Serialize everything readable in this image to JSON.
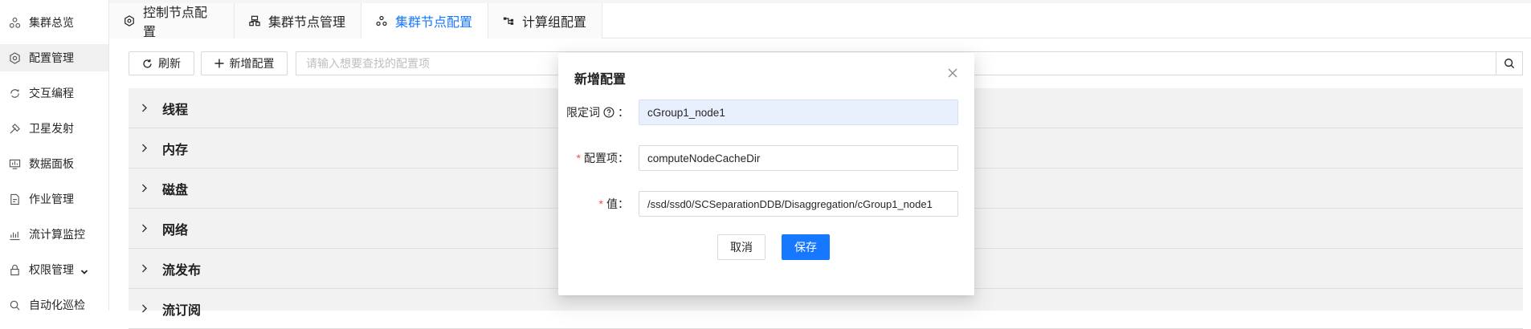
{
  "sidebar": {
    "items": [
      {
        "label": "集群总览",
        "icon": "cluster-overview-icon",
        "active": false
      },
      {
        "label": "配置管理",
        "icon": "settings-icon",
        "active": true
      },
      {
        "label": "交互编程",
        "icon": "interactive-icon",
        "active": false
      },
      {
        "label": "卫星发射",
        "icon": "satellite-icon",
        "active": false
      },
      {
        "label": "数据面板",
        "icon": "dashboard-icon",
        "active": false
      },
      {
        "label": "作业管理",
        "icon": "job-icon",
        "active": false
      },
      {
        "label": "流计算监控",
        "icon": "stream-monitor-icon",
        "active": false
      },
      {
        "label": "权限管理",
        "icon": "lock-icon",
        "active": false,
        "expandable": true
      },
      {
        "label": "自动化巡检",
        "icon": "inspection-icon",
        "active": false
      }
    ]
  },
  "tabs": [
    {
      "label": "控制节点配置",
      "icon": "controller-node-icon",
      "active": false
    },
    {
      "label": "集群节点管理",
      "icon": "cluster-node-manage-icon",
      "active": false
    },
    {
      "label": "集群节点配置",
      "icon": "cluster-node-config-icon",
      "active": true
    },
    {
      "label": "计算组配置",
      "icon": "compute-group-icon",
      "active": false
    }
  ],
  "toolbar": {
    "refresh_label": "刷新",
    "add_label": "新增配置",
    "search_placeholder": "请输入想要查找的配置项"
  },
  "panels": [
    "线程",
    "内存",
    "磁盘",
    "网络",
    "流发布",
    "流订阅"
  ],
  "modal": {
    "title": "新增配置",
    "qualifier_label": "限定词",
    "qualifier_suffix": "：",
    "qualifier_value": "cGroup1_node1",
    "config_label": "配置项：",
    "config_value": "computeNodeCacheDir",
    "value_label": "值：",
    "value_value": "/ssd/ssd0/SCSeparationDDB/Disaggregation/cGroup1_node1",
    "required_mark": "*",
    "cancel_label": "取消",
    "save_label": "保存"
  },
  "colors": {
    "accent": "#1677ff",
    "required": "#ff4d4f",
    "panel_bg": "#f2f2f2",
    "autofill_bg": "#e8f0fe"
  }
}
